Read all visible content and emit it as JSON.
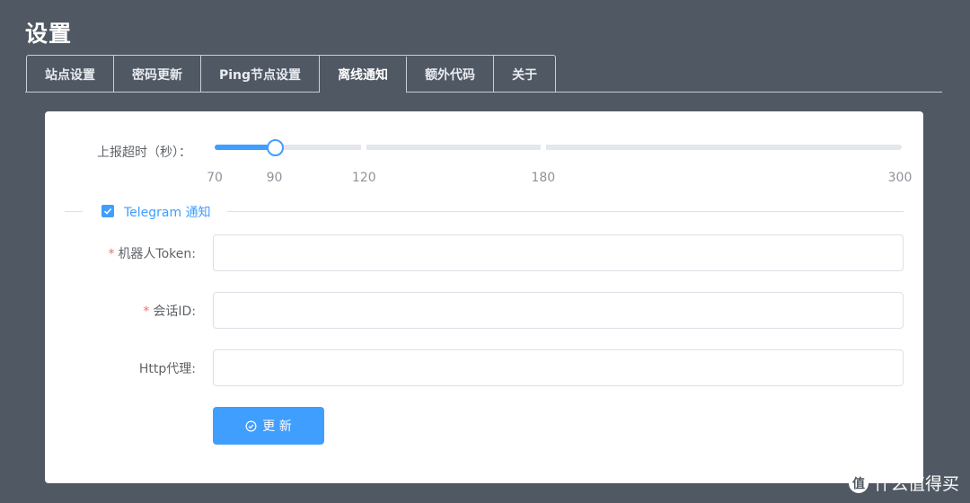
{
  "page": {
    "title": "设置"
  },
  "tabs": [
    {
      "label": "站点设置",
      "active": false
    },
    {
      "label": "密码更新",
      "active": false
    },
    {
      "label": "Ping节点设置",
      "active": false
    },
    {
      "label": "离线通知",
      "active": true
    },
    {
      "label": "额外代码",
      "active": false
    },
    {
      "label": "关于",
      "active": false
    }
  ],
  "timeout_slider": {
    "label": "上报超时（秒）：",
    "min": 70,
    "max": 300,
    "value": 90,
    "marks": [
      "70",
      "90",
      "120",
      "180",
      "300"
    ]
  },
  "telegram": {
    "label": "Telegram 通知",
    "checked": true
  },
  "form": {
    "token_label": "机器人Token:",
    "chat_id_label": "会话ID:",
    "proxy_label": "Http代理:",
    "required_mark": "*",
    "token_value": "",
    "chat_id_value": "",
    "proxy_value": ""
  },
  "submit": {
    "label": "更 新"
  },
  "watermark": {
    "logo": "值",
    "text": "什么值得买"
  },
  "colors": {
    "background": "#505863",
    "primary": "#409eff",
    "required": "#f56c6c"
  }
}
